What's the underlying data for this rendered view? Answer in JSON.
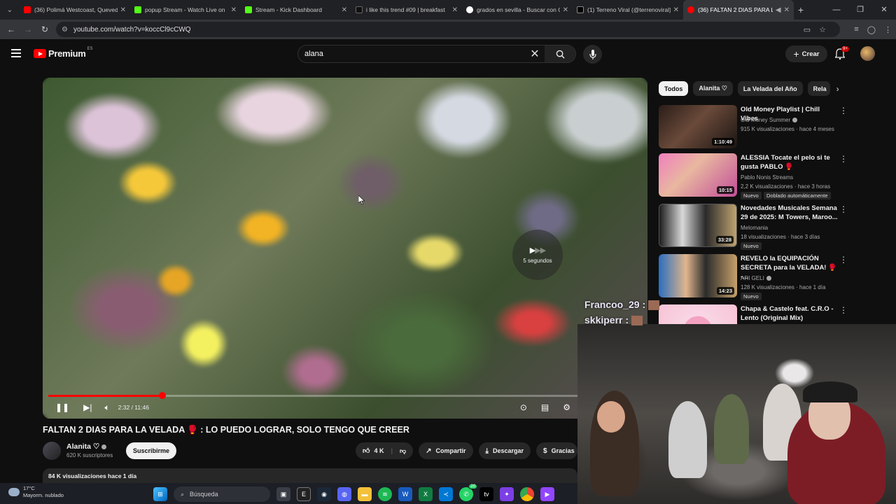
{
  "browser": {
    "tabs": [
      {
        "label": "(36) Polimá Westcoast, Quevedo",
        "color": "#ff0000"
      },
      {
        "label": "popup Stream - Watch Live on",
        "color": "#53fc18"
      },
      {
        "label": "Stream - Kick Dashboard",
        "color": "#53fc18"
      },
      {
        "label": "i like this trend #09 | breakfast",
        "color": "#111111"
      },
      {
        "label": "grados en sevilla - Buscar con G",
        "color": "#ffffff"
      },
      {
        "label": "(1) Terreno Viral (@terrenoviral)",
        "color": "#000000"
      },
      {
        "label": "(36) FALTAN 2 DIAS PARA L",
        "color": "#ff0000",
        "active": true
      }
    ],
    "url": "youtube.com/watch?v=koccCl9cCWQ"
  },
  "header": {
    "brand": "Premium",
    "country": "ES",
    "search_query": "alana",
    "create_label": "Crear",
    "notif_count": "9+"
  },
  "player": {
    "time": "2:32 / 11:46",
    "progress_fraction": 0.215,
    "skip_label": "5 segundos"
  },
  "video": {
    "title": "FALTAN 2 DIAS PARA LA VELADA 🥊 : LO PUEDO LOGRAR, SOLO TENGO QUE CREER",
    "channel": "Alanita ♡",
    "subscribers": "620 K suscriptores",
    "subscribe_label": "Suscribirme",
    "likes": "4 K",
    "share_label": "Compartir",
    "download_label": "Descargar",
    "thanks_label": "Gracias",
    "views_date": "84 K visualizaciones  hace 1 día"
  },
  "chips": [
    "Todos",
    "Alanita ♡",
    "La Velada del Año",
    "Rela"
  ],
  "recommendations": [
    {
      "title": "Old Money Playlist | Chill Vibes",
      "channel": "Old Money Summer",
      "meta": "915 K visualizaciones · hace 4 meses",
      "duration": "1:10:49",
      "badges": []
    },
    {
      "title": "ALESSIA Tocate el pelo si te gusta PABLO 🥊",
      "channel": "Pablo Nonis Streams",
      "meta": "2,2 K visualizaciones · hace 3 horas",
      "duration": "10:15",
      "badges": [
        "Nuevo",
        "Doblado automáticamente"
      ]
    },
    {
      "title": "Novedades Musicales Semana 29 de 2025: M Towers, Maroo...",
      "channel": "Melomania",
      "meta": "18 visualizaciones · hace 3 días",
      "duration": "33:28",
      "badges": [
        "Nuevo"
      ]
    },
    {
      "title": "REVELO la EQUIPACIÓN SECRETA para la VELADA! 🥊 -...",
      "channel": "ARI GELI",
      "meta": "128 K visualizaciones · hace 1 día",
      "duration": "14:23",
      "badges": [
        "Nuevo"
      ]
    },
    {
      "title": "Chapa & Castelo feat. C.R.O - Lento (Original Mix)",
      "channel": "",
      "meta": "",
      "duration": "",
      "badges": []
    }
  ],
  "stream_overlay": {
    "chat": [
      "Francoo_29 :",
      "skkiperr :"
    ]
  },
  "taskbar": {
    "temp": "17°C",
    "weather": "Mayorm. nublado",
    "search_placeholder": "Búsqueda",
    "whatsapp_count": "20"
  }
}
